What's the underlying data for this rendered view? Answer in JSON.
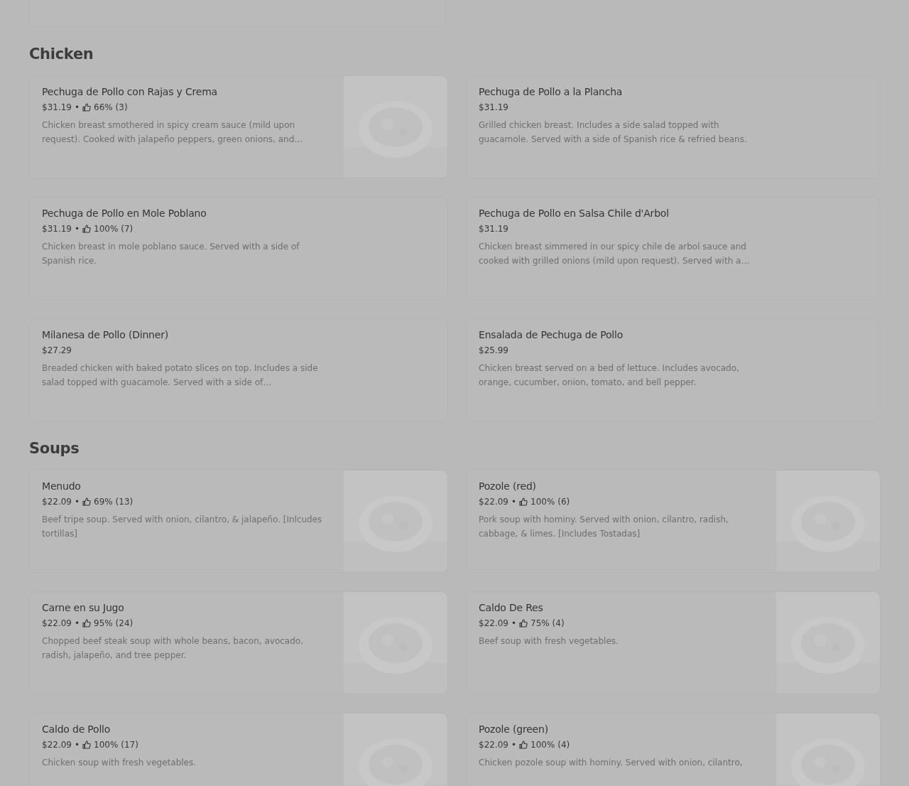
{
  "sections": [
    {
      "title": "Chicken",
      "items": [
        {
          "name": "Pechuga de Pollo con Rajas y Crema",
          "price": "$31.19",
          "separator": "•",
          "rating": "66% (3)",
          "description": "Chicken breast smothered in spicy cream sauce (mild upon request). Cooked with jalapeño peppers, green onions, and…",
          "image": true
        },
        {
          "name": "Pechuga de Pollo a la Plancha",
          "price": "$31.19",
          "description": "Grilled chicken breast. Includes a side salad topped with guacamole. Served with a side of Spanish rice & refried beans.",
          "image": false
        },
        {
          "name": "Pechuga de Pollo en Mole Poblano",
          "price": "$31.19",
          "separator": "•",
          "rating": "100% (7)",
          "description": "Chicken breast in mole poblano sauce. Served with a side of Spanish rice.",
          "image": false
        },
        {
          "name": "Pechuga de Pollo en Salsa Chile d'Arbol",
          "price": "$31.19",
          "description": "Chicken breast simmered in our spicy chile de arbol sauce and cooked with grilled onions (mild upon request). Served with a…",
          "image": false
        },
        {
          "name": "Milanesa de Pollo (Dinner)",
          "price": "$27.29",
          "description": "Breaded chicken with baked potato slices on top. Includes a side salad topped with guacamole. Served with a side of…",
          "image": false
        },
        {
          "name": "Ensalada de Pechuga de Pollo",
          "price": "$25.99",
          "description": "Chicken breast served on a bed of lettuce. Includes avocado, orange, cucumber, onion, tomato, and bell pepper.",
          "image": false
        }
      ]
    },
    {
      "title": "Soups",
      "items": [
        {
          "name": "Menudo",
          "price": "$22.09",
          "separator": "•",
          "rating": "69% (13)",
          "description": "Beef tripe soup. Served with onion, cilantro, & jalapeño. [Inlcudes tortillas]",
          "image": true
        },
        {
          "name": "Pozole (red)",
          "price": "$22.09",
          "separator": "•",
          "rating": "100% (6)",
          "description": "Pork soup with hominy. Served with onion, cilantro, radish, cabbage, & limes. [Includes Tostadas]",
          "image": true
        },
        {
          "name": "Carne en su Jugo",
          "price": "$22.09",
          "separator": "•",
          "rating": "95% (24)",
          "description": "Chopped beef steak soup with whole beans, bacon, avocado, radish, jalapeño, and tree pepper.",
          "image": true
        },
        {
          "name": "Caldo De Res",
          "price": "$22.09",
          "separator": "•",
          "rating": "75% (4)",
          "description": "Beef soup with fresh vegetables.",
          "image": true
        },
        {
          "name": "Caldo de Pollo",
          "price": "$22.09",
          "separator": "•",
          "rating": "100% (17)",
          "description": "Chicken soup with fresh vegetables.",
          "image": true
        },
        {
          "name": "Pozole (green)",
          "price": "$22.09",
          "separator": "•",
          "rating": "100% (4)",
          "description": "Chicken pozole soup with hominy. Served with onion, cilantro,",
          "image": true
        }
      ]
    }
  ]
}
